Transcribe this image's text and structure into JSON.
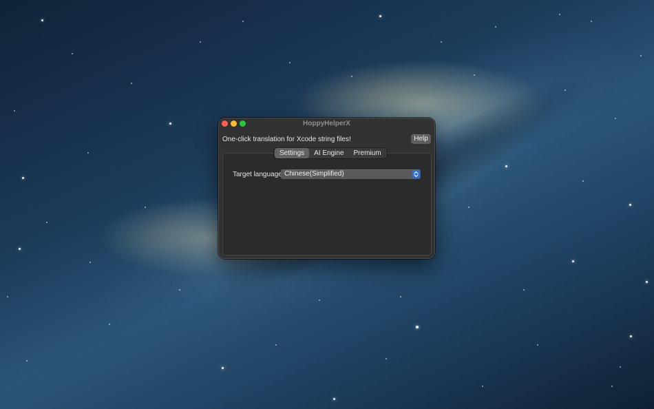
{
  "window": {
    "title": "HoppyHelperX"
  },
  "header": {
    "tagline": "One-click translation for Xcode string files!",
    "help_label": "Help"
  },
  "tabs": [
    {
      "label": "Settings",
      "selected": true
    },
    {
      "label": "AI Engine",
      "selected": false
    },
    {
      "label": "Premium",
      "selected": false
    }
  ],
  "settings": {
    "target_language_label": "Target language",
    "target_language_value": "Chinese(Simplified)"
  },
  "icons": {
    "close": "close-icon",
    "minimize": "minimize-icon",
    "zoom": "zoom-icon",
    "popup": "chevron-up-down-icon"
  },
  "colors": {
    "close": "#ff5f57",
    "minimize": "#febc2e",
    "zoom": "#28c840",
    "accent": "#2f6fdc"
  }
}
